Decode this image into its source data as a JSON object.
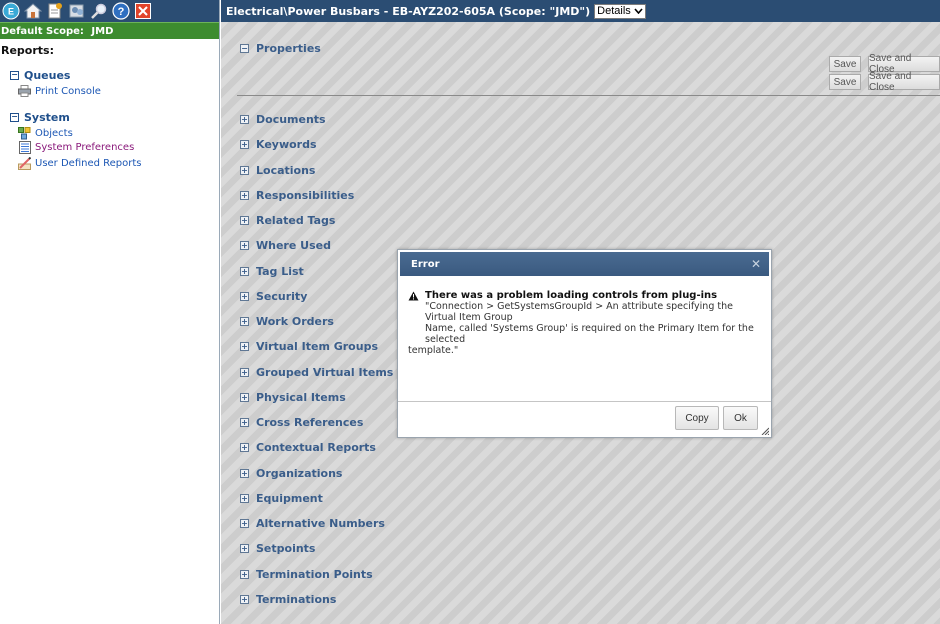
{
  "sidebar": {
    "toolbar_icons": [
      "app-logo-icon",
      "home-icon",
      "document-icon",
      "users-icon",
      "search-icon",
      "help-icon",
      "close-icon"
    ],
    "scope_label": "Default Scope:",
    "scope_value": "JMD",
    "reports_title": "Reports:",
    "sections": [
      {
        "label": "Queues",
        "items": [
          {
            "label": "Print Console",
            "icon": "printer-icon"
          }
        ]
      },
      {
        "label": "System",
        "items": [
          {
            "label": "Objects",
            "icon": "objects-icon"
          },
          {
            "label": "System Preferences",
            "icon": "preferences-icon"
          },
          {
            "label": "User Defined Reports",
            "icon": "report-pencil-icon"
          }
        ]
      }
    ]
  },
  "main": {
    "title": "Electrical\\Power Busbars - EB-AYZ202-605A (Scope: \"JMD\")",
    "view_select": "Details",
    "properties_label": "Properties",
    "buttons": {
      "save": "Save",
      "save_close": "Save and Close"
    },
    "sections": [
      "Documents",
      "Keywords",
      "Locations",
      "Responsibilities",
      "Related Tags",
      "Where Used",
      "Tag List",
      "Security",
      "Work Orders",
      "Virtual Item Groups",
      "Grouped Virtual Items",
      "Physical Items",
      "Cross References",
      "Contextual Reports",
      "Organizations",
      "Equipment",
      "Alternative Numbers",
      "Setpoints",
      "Termination Points",
      "Terminations"
    ]
  },
  "dialog": {
    "title": "Error",
    "message_title": "There was a problem loading controls from plug-ins",
    "message_line1": "\"Connection > GetSystemsGroupId > An attribute specifying the Virtual Item Group",
    "message_line2": "Name, called 'Systems Group' is required on the Primary Item for the selected",
    "message_line3": "template.\"",
    "copy_button": "Copy",
    "ok_button": "Ok"
  },
  "colors": {
    "header_blue": "#2b4d73",
    "scope_green": "#3d8c2f",
    "link_blue": "#1c57b4",
    "section_blue": "#3a5d8a"
  }
}
